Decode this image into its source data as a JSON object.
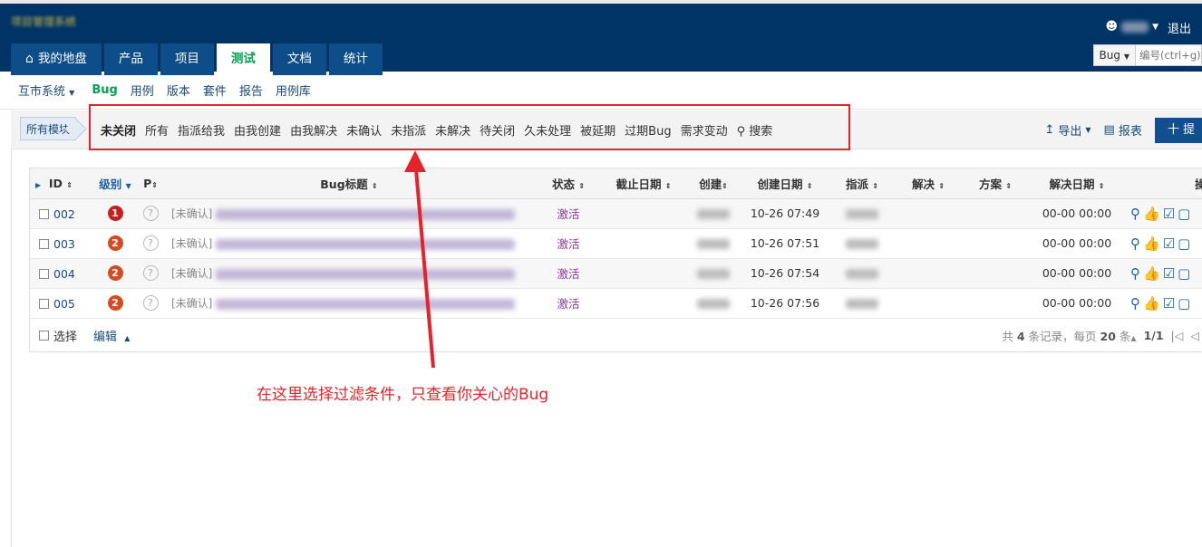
{
  "header": {
    "brand": "项目管理系统",
    "user_menu_icon": "user-icon",
    "logout": "退出",
    "tabs": [
      {
        "label": "我的地盘",
        "icon": "home-icon"
      },
      {
        "label": "产品"
      },
      {
        "label": "项目"
      },
      {
        "label": "测试"
      },
      {
        "label": "文档"
      },
      {
        "label": "统计"
      }
    ],
    "active_tab": "测试",
    "search": {
      "type": "Bug",
      "placeholder": "编号(ctrl+g)"
    }
  },
  "subnav": {
    "product": "互市系统",
    "items": [
      "Bug",
      "用例",
      "版本",
      "套件",
      "报告",
      "用例库"
    ],
    "active": "Bug"
  },
  "featurebar": {
    "module": "所有模块",
    "filters": [
      "未关闭",
      "所有",
      "指派给我",
      "由我创建",
      "由我解决",
      "未确认",
      "未指派",
      "未解决",
      "待关闭",
      "久未处理",
      "被延期",
      "过期Bug",
      "需求变动"
    ],
    "active_filter": "未关闭",
    "search": "搜索",
    "export": "导出",
    "report": "报表",
    "create": "十 提"
  },
  "table": {
    "headers": {
      "id": "ID",
      "severity": "级别",
      "pri": "P",
      "title": "Bug标题",
      "status": "状态",
      "deadline": "截止日期",
      "opened_by": "创建",
      "opened_date": "创建日期",
      "assigned": "指派",
      "resolved_by": "解决",
      "resolution": "方案",
      "resolved_date": "解决日期",
      "actions": "操作"
    },
    "rows": [
      {
        "id": "002",
        "severity": "1",
        "pri": "?",
        "prefix": "[未确认]",
        "title_tail": "...",
        "status": "激活",
        "opened_date": "10-26 07:49",
        "resolved_date": "00-00 00:00"
      },
      {
        "id": "003",
        "severity": "2",
        "pri": "?",
        "prefix": "[未确认]",
        "title_tail": "",
        "status": "激活",
        "opened_date": "10-26 07:51",
        "resolved_date": "00-00 00:00"
      },
      {
        "id": "004",
        "severity": "2",
        "pri": "?",
        "prefix": "[未确认]",
        "title_tail": "",
        "status": "激活",
        "opened_date": "10-26 07:54",
        "resolved_date": "00-00 00:00"
      },
      {
        "id": "005",
        "severity": "2",
        "pri": "?",
        "prefix": "[未确认]",
        "title_tail": "",
        "status": "激活",
        "opened_date": "10-26 07:56",
        "resolved_date": "00-00 00:00"
      }
    ]
  },
  "footer": {
    "select_all": "选择",
    "edit": "编辑",
    "total_prefix": "共",
    "total_count": "4",
    "total_suffix": "条记录，每页",
    "per_page": "20",
    "per_page_suffix": "条",
    "page": "1/1"
  },
  "annotation": {
    "text": "在这里选择过滤条件，只查看你关心的Bug",
    "color": "#e5232a"
  },
  "colors": {
    "header_bg": "#003366",
    "tab_bg": "#0c4d8a",
    "active_green": "#03a353",
    "status_purple": "#8c3b9b"
  }
}
